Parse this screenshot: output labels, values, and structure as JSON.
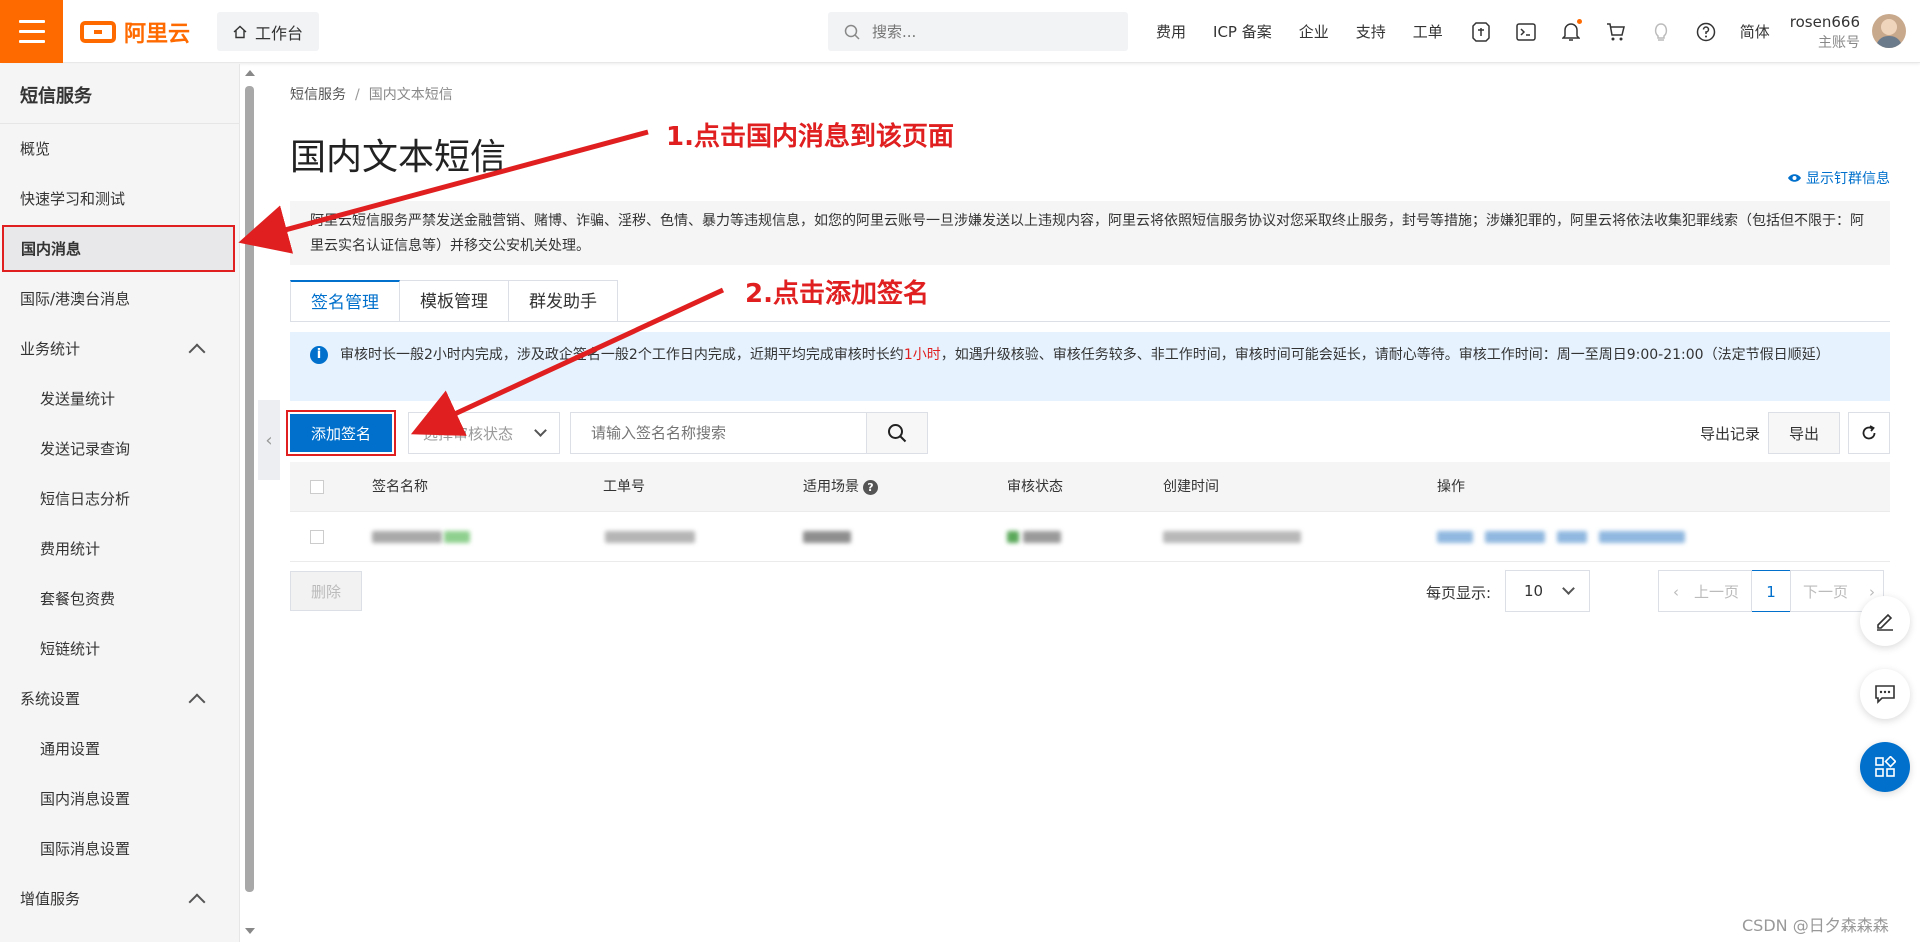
{
  "header": {
    "brand": "阿里云",
    "workbench": "工作台",
    "search_placeholder": "搜索...",
    "nav_links": [
      "费用",
      "ICP 备案",
      "企业",
      "支持",
      "工单",
      "简体"
    ],
    "account_name": "rosen666",
    "account_role": "主账号"
  },
  "sidebar": {
    "title": "短信服务",
    "items": [
      {
        "label": "概览"
      },
      {
        "label": "快速学习和测试"
      },
      {
        "label": "国内消息"
      },
      {
        "label": "国际/港澳台消息"
      },
      {
        "label": "业务统计"
      },
      {
        "label": "发送量统计"
      },
      {
        "label": "发送记录查询"
      },
      {
        "label": "短信日志分析"
      },
      {
        "label": "费用统计"
      },
      {
        "label": "套餐包资费"
      },
      {
        "label": "短链统计"
      },
      {
        "label": "系统设置"
      },
      {
        "label": "通用设置"
      },
      {
        "label": "国内消息设置"
      },
      {
        "label": "国际消息设置"
      },
      {
        "label": "增值服务"
      }
    ]
  },
  "main": {
    "breadcrumb": [
      "短信服务",
      "/",
      "国内文本短信"
    ],
    "title": "国内文本短信",
    "show_subscription": "显示钉群信息",
    "warning": "阿里云短信服务严禁发送金融营销、赌博、诈骗、淫秽、色情、暴力等违规信息，如您的阿里云账号一旦涉嫌发送以上违规内容，阿里云将依照短信服务协议对您采取终止服务，封号等措施；涉嫌犯罪的，阿里云将依法收集犯罪线索（包括但不限于：阿里云实名认证信息等）并移交公安机关处理。",
    "tabs": [
      "签名管理",
      "模板管理",
      "群发助手"
    ],
    "info_before": "审核时长一般2小时内完成，涉及政企签名一般2个工作日内完成，近期平均完成审核时长约",
    "info_highlight": "1小时",
    "info_after": "，如遇升级核验、审核任务较多、非工作时间，审核时间可能会延长，请耐心等待。审核工作时间：周一至周日9:00-21:00（法定节假日顺延）",
    "add_button": "添加签名",
    "status_placeholder": "选择审核状态",
    "name_search_placeholder": "请输入签名名称搜索",
    "export_records": "导出记录",
    "export_button": "导出",
    "table_headers": [
      "签名名称",
      "工单号",
      "适用场景",
      "审核状态",
      "创建时间",
      "操作"
    ],
    "delete_button": "删除",
    "page_size_label": "每页显示:",
    "page_size": "10",
    "prev_page": "上一页",
    "current_page": "1",
    "next_page": "下一页"
  },
  "annotations": {
    "step1": "1.点击国内消息到该页面",
    "step2": "2.点击添加签名"
  },
  "watermark": "CSDN @日夕森森森",
  "colors": {
    "brand": "#ff6a00",
    "primary": "#0070cc",
    "annotation": "#e02020"
  }
}
